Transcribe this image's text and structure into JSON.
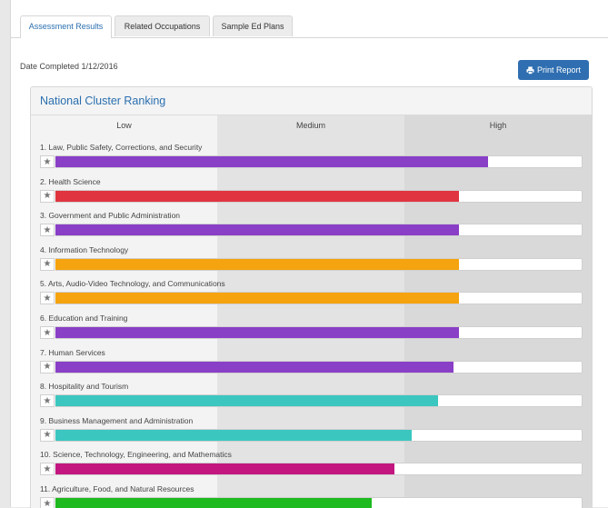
{
  "tabs": [
    {
      "label": "Assessment Results",
      "active": true
    },
    {
      "label": "Related Occupations",
      "active": false
    },
    {
      "label": "Sample Ed Plans",
      "active": false
    }
  ],
  "date_completed": "Date Completed 1/12/2016",
  "print_button": {
    "label": "Print Report",
    "icon": "print-icon"
  },
  "panel": {
    "title": "National Cluster Ranking",
    "zones": [
      "Low",
      "Medium",
      "High"
    ]
  },
  "rankings": [
    {
      "label": "1. Law, Public Safety, Corrections, and Security",
      "score": 0.82,
      "color": "#8a3fc7"
    },
    {
      "label": "2. Health Science",
      "score": 0.765,
      "color": "#e03540"
    },
    {
      "label": "3. Government and Public Administration",
      "score": 0.765,
      "color": "#8a3fc7"
    },
    {
      "label": "4. Information Technology",
      "score": 0.765,
      "color": "#f5a30e"
    },
    {
      "label": "5. Arts, Audio-Video Technology, and Communications",
      "score": 0.765,
      "color": "#f5a30e"
    },
    {
      "label": "6. Education and Training",
      "score": 0.765,
      "color": "#8a3fc7"
    },
    {
      "label": "7. Human Services",
      "score": 0.755,
      "color": "#8a3fc7"
    },
    {
      "label": "8. Hospitality and Tourism",
      "score": 0.725,
      "color": "#3cc6c0"
    },
    {
      "label": "9. Business Management and Administration",
      "score": 0.675,
      "color": "#3cc6c0"
    },
    {
      "label": "10. Science, Technology, Engineering, and Mathematics",
      "score": 0.643,
      "color": "#c3177f"
    },
    {
      "label": "11. Agriculture, Food, and Natural Resources",
      "score": 0.6,
      "color": "#1fba1f"
    }
  ]
}
